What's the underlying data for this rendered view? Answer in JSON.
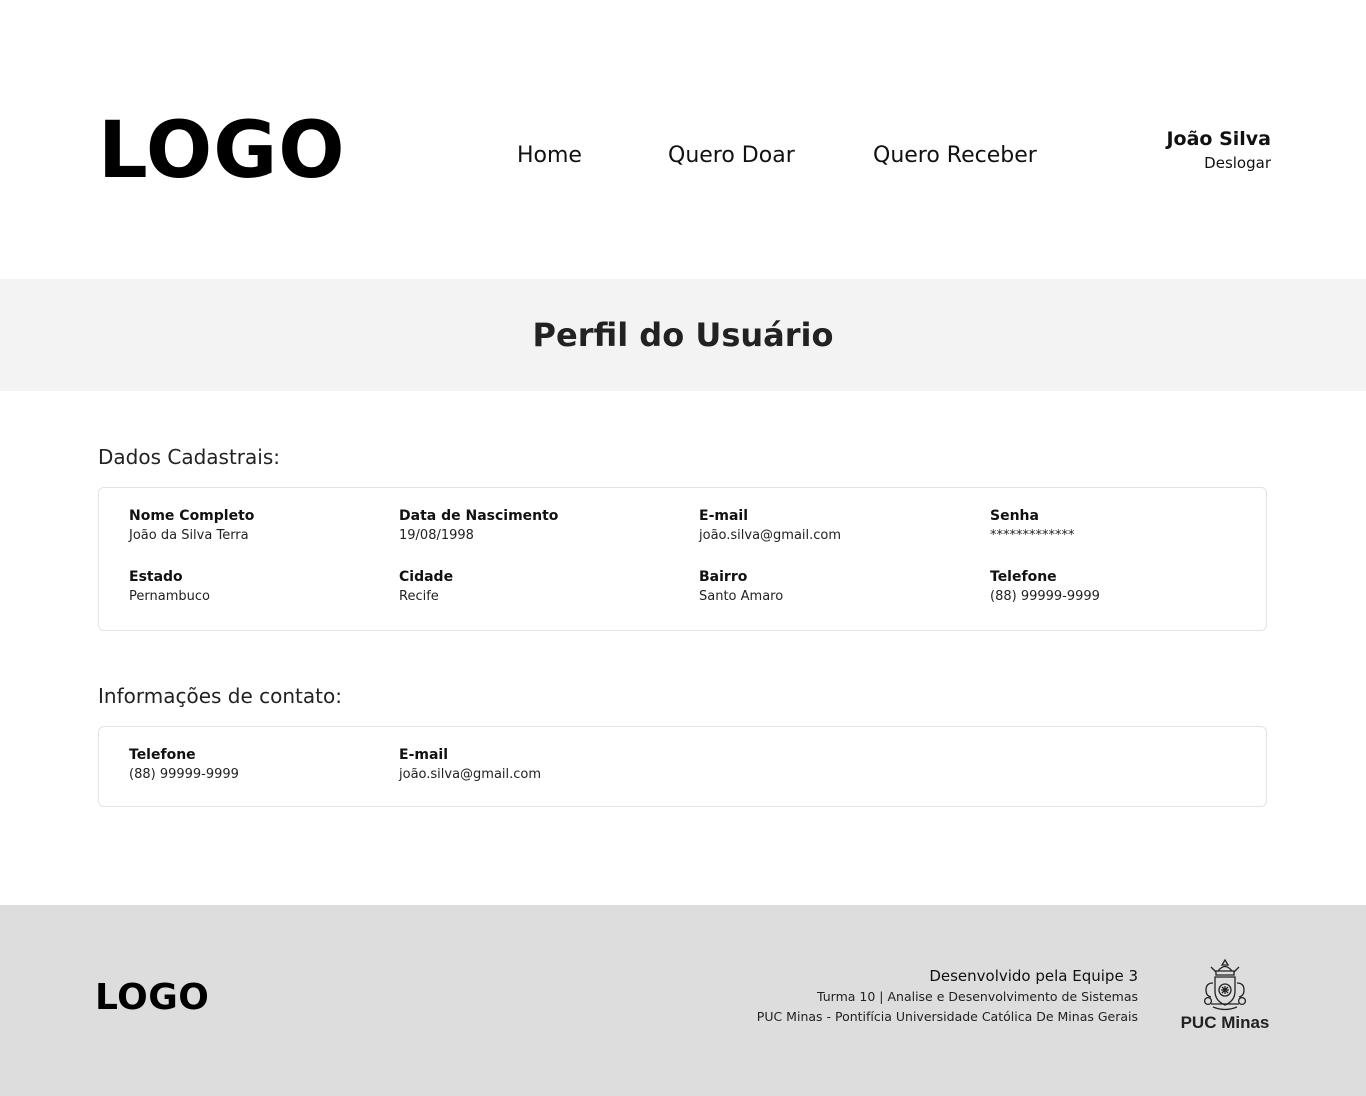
{
  "header": {
    "logo": "LOGO",
    "nav": [
      {
        "label": "Home"
      },
      {
        "label": "Quero Doar"
      },
      {
        "label": "Quero Receber"
      }
    ],
    "user": {
      "name": "João Silva",
      "logout": "Deslogar"
    }
  },
  "page": {
    "title": "Perfil do Usuário"
  },
  "registration": {
    "title": "Dados Cadastrais:",
    "fields": [
      {
        "label": "Nome Completo",
        "value": "João da Silva Terra"
      },
      {
        "label": "Data de Nascimento",
        "value": "19/08/1998"
      },
      {
        "label": "E-mail",
        "value": "joão.silva@gmail.com"
      },
      {
        "label": "Senha",
        "value": "*************"
      },
      {
        "label": "Estado",
        "value": "Pernambuco"
      },
      {
        "label": "Cidade",
        "value": "Recife"
      },
      {
        "label": "Bairro",
        "value": "Santo Amaro"
      },
      {
        "label": "Telefone",
        "value": "(88) 99999-9999"
      }
    ]
  },
  "contact": {
    "title": "Informações de contato:",
    "fields": [
      {
        "label": "Telefone",
        "value": "(88) 99999-9999"
      },
      {
        "label": "E-mail",
        "value": "joão.silva@gmail.com"
      }
    ]
  },
  "footer": {
    "logo": "LOGO",
    "credit": "Desenvolvido pela Equipe 3",
    "class_info": "Turma 10 | Analise e Desenvolvimento de Sistemas",
    "university": "PUC Minas - Pontifícia Universidade Católica De Minas Gerais",
    "puc_label": "PUC Minas",
    "puc_icon": "coat-of-arms-icon"
  },
  "colors": {
    "title_band": "#f3f3f3",
    "footer_bg": "#dddddd",
    "card_border": "#e4e4e4"
  }
}
